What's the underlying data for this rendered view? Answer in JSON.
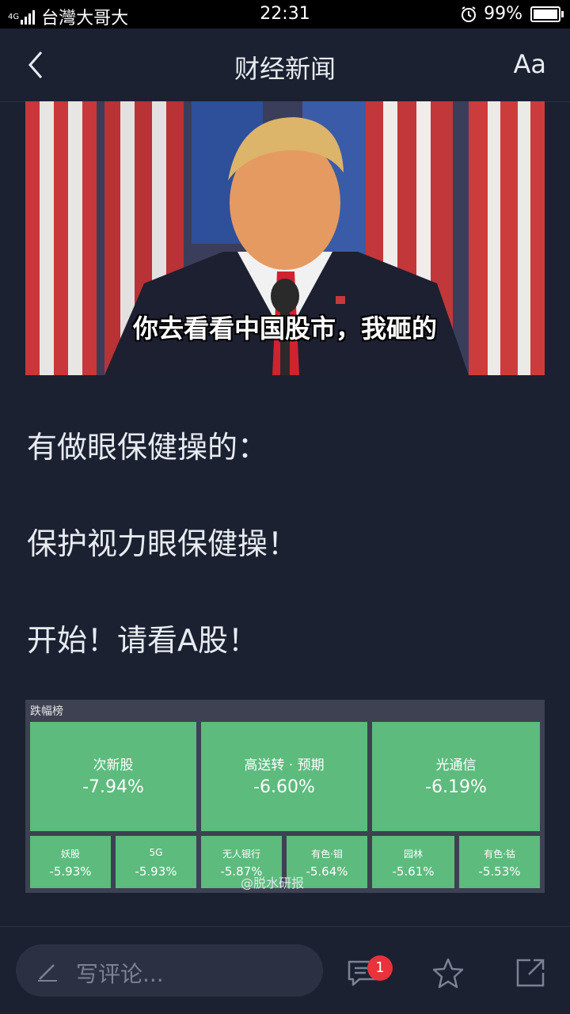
{
  "status_bar": {
    "network": "4G",
    "carrier": "台灣大哥大",
    "time": "22:31",
    "alarm_icon": "alarm-clock-icon",
    "battery_percent": "99%",
    "battery_level": 0.99
  },
  "nav": {
    "back_icon": "chevron-left-icon",
    "title": "财经新闻",
    "font_label": "Aa"
  },
  "article": {
    "image_caption": "你去看看中国股市，我砸的",
    "paragraphs": [
      "有做眼保健操的：",
      "保护视力眼保健操！",
      "开始！请看A股！"
    ],
    "heatmap": {
      "title": "跌幅榜",
      "tile_color": "#5dbb7d",
      "big_tiles": [
        {
          "label": "次新股",
          "value": "-7.94%"
        },
        {
          "label": "高送转 · 预期",
          "value": "-6.60%"
        },
        {
          "label": "光通信",
          "value": "-6.19%"
        }
      ],
      "small_tiles": [
        {
          "label": "妖股",
          "value": "-5.93%"
        },
        {
          "label": "5G",
          "value": "-5.93%"
        },
        {
          "label": "无人银行",
          "value": "-5.87%"
        },
        {
          "label": "有色·钼",
          "value": "-5.64%"
        },
        {
          "label": "园林",
          "value": "-5.61%"
        },
        {
          "label": "有色·钴",
          "value": "-5.53%"
        }
      ],
      "watermark": "@脱水研报"
    }
  },
  "bottom_bar": {
    "comment_placeholder": "写评论...",
    "comment_count": "1",
    "badge_color": "#e8323c",
    "icons": [
      "pencil-icon",
      "comment-icon",
      "star-icon",
      "share-icon"
    ]
  }
}
